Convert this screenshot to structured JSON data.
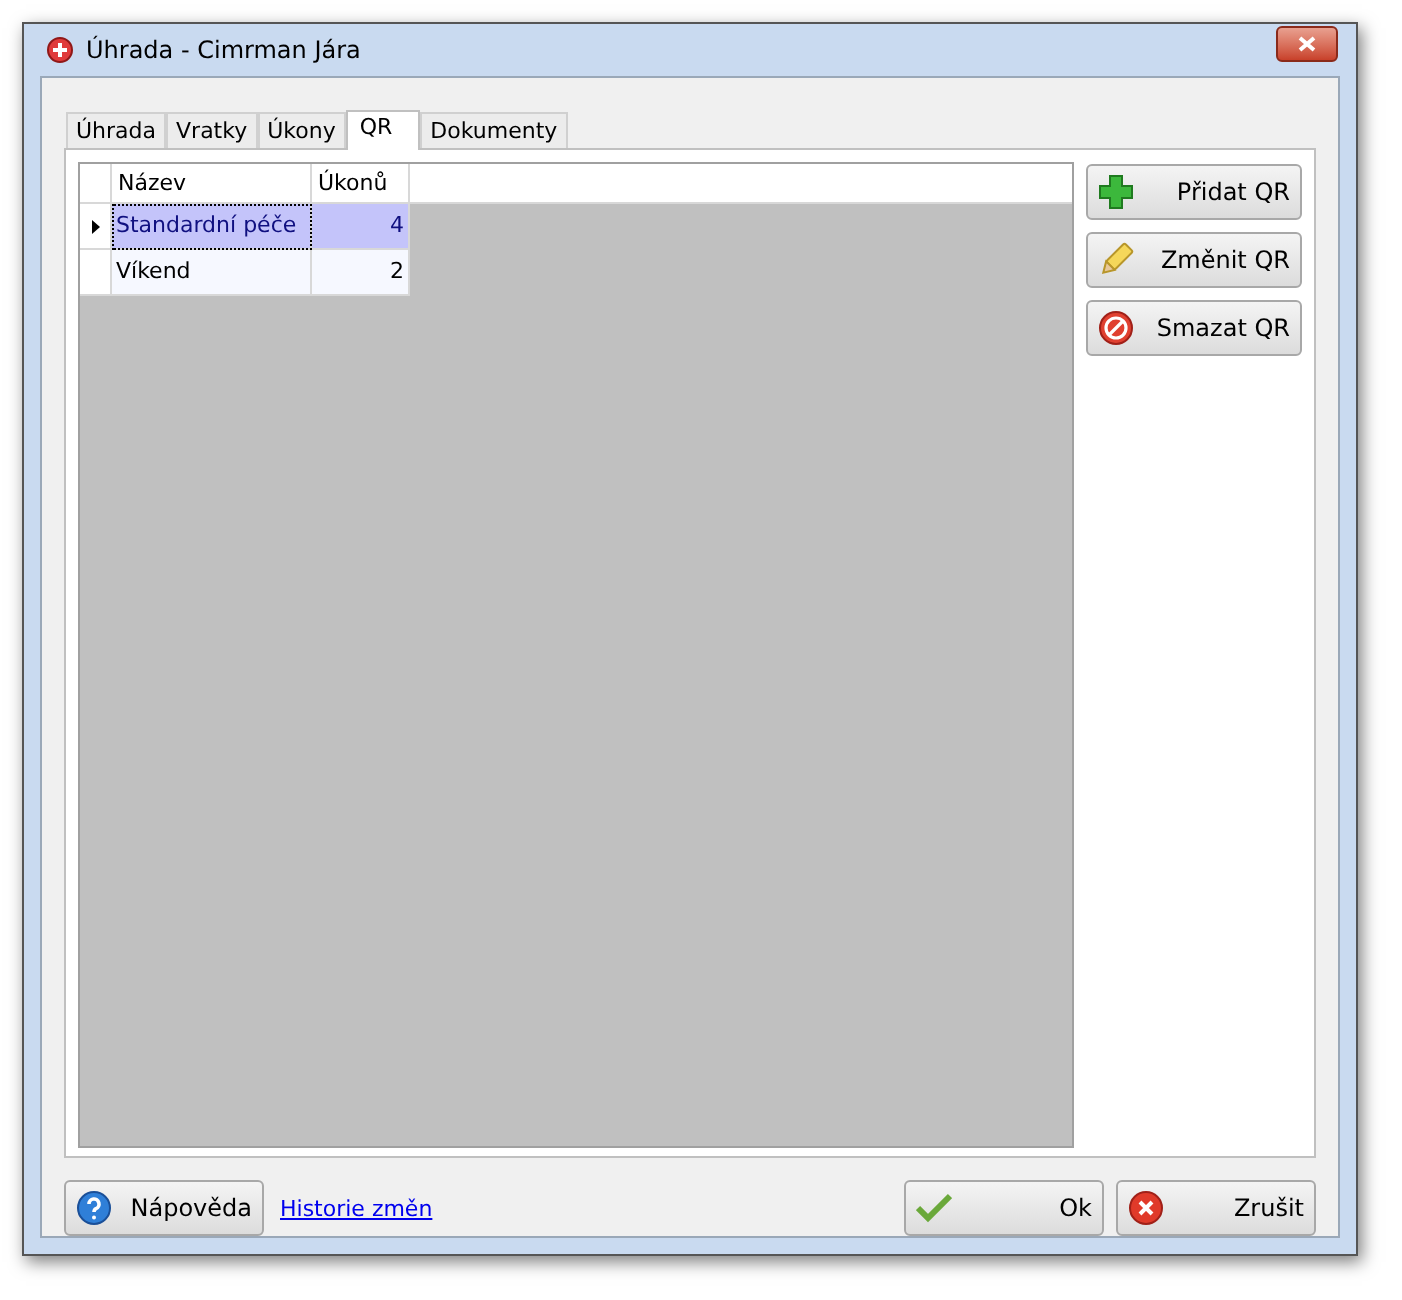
{
  "window": {
    "title": "Úhrada - Cimrman Jára"
  },
  "tabs": [
    {
      "label": "Úhrada",
      "selected": false
    },
    {
      "label": "Vratky",
      "selected": false
    },
    {
      "label": "Úkony",
      "selected": false
    },
    {
      "label": "QR",
      "selected": true
    },
    {
      "label": "Dokumenty",
      "selected": false
    }
  ],
  "table": {
    "columns": [
      "Název",
      "Úkonů"
    ],
    "rows": [
      {
        "cells": [
          "Standardní péče",
          "4"
        ],
        "selected": true
      },
      {
        "cells": [
          "Víkend",
          "2"
        ],
        "selected": false
      }
    ]
  },
  "side_buttons": [
    {
      "label": "Přidat QR",
      "kind": "add"
    },
    {
      "label": "Změnit QR",
      "kind": "edit"
    },
    {
      "label": "Smazat QR",
      "kind": "delete"
    }
  ],
  "footer": {
    "help_button": {
      "label": "Nápověda",
      "kind": "help"
    },
    "link": "Historie změn",
    "buttons": [
      {
        "label": "Ok",
        "kind": "ok"
      },
      {
        "label": "Zrušit",
        "kind": "cancel"
      }
    ]
  }
}
